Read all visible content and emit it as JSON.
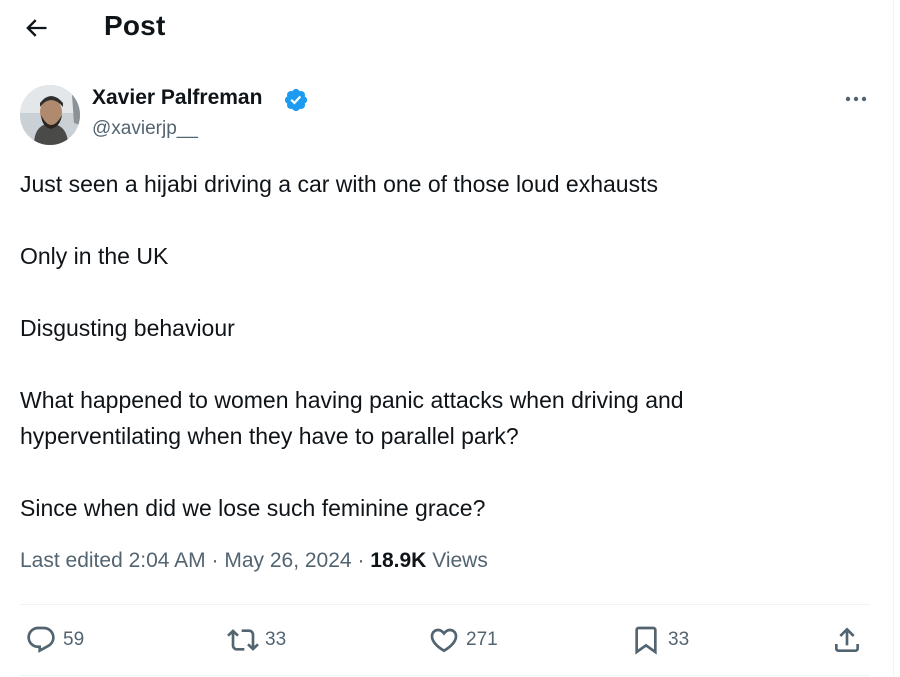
{
  "header": {
    "title": "Post"
  },
  "author": {
    "name": "Xavier Palfreman",
    "handle": "@xavierjp__"
  },
  "tweet": {
    "paragraphs": [
      "Just seen a hijabi driving a car with one of those loud exhausts",
      "Only in the UK",
      "Disgusting behaviour",
      "What happened to women having panic attacks when driving and hyperventilating when they have to parallel park?",
      "Since when did we lose such feminine grace?"
    ]
  },
  "meta": {
    "edited_prefix": "Last edited",
    "time": "2:04 AM",
    "separator": "·",
    "date": "May 26, 2024",
    "views_count": "18.9K",
    "views_label": "Views"
  },
  "actions": {
    "replies": "59",
    "reposts": "33",
    "likes": "271",
    "bookmarks": "33"
  },
  "colors": {
    "text": "#0f1419",
    "secondary": "#536471",
    "verified": "#1d9bf0",
    "divider": "#eff3f4"
  },
  "icons": [
    "back-arrow-icon",
    "verified-badge-icon",
    "more-options-icon",
    "reply-icon",
    "repost-icon",
    "like-icon",
    "bookmark-icon",
    "share-icon"
  ]
}
